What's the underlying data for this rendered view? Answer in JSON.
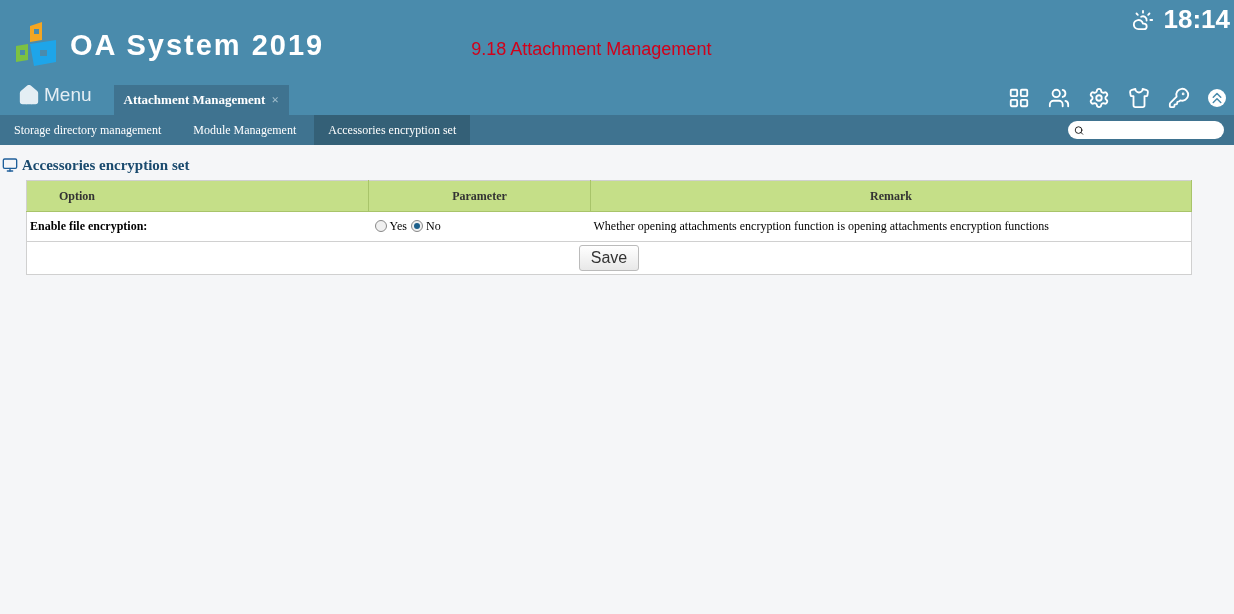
{
  "header": {
    "app_title": "OA System 2019",
    "page_title": "9.18 Attachment Management",
    "clock": "18:14"
  },
  "menu": {
    "label": "Menu"
  },
  "open_tabs": [
    {
      "label": "Attachment Management",
      "selected": true,
      "close": "×"
    }
  ],
  "subnav": [
    {
      "label": "Storage directory management",
      "selected": false
    },
    {
      "label": "Module Management",
      "selected": false
    },
    {
      "label": "Accessories encryption set",
      "selected": true
    }
  ],
  "section_title": "Accessories encryption set",
  "table": {
    "columns": [
      "Option",
      "Parameter",
      "Remark"
    ],
    "rows": [
      {
        "option": "Enable file encryption:",
        "choices": [
          {
            "label": "Yes",
            "selected": false
          },
          {
            "label": "No",
            "selected": true
          }
        ],
        "remark": "Whether opening attachments encryption function is opening attachments encryption functions"
      }
    ]
  },
  "save_button": "Save"
}
